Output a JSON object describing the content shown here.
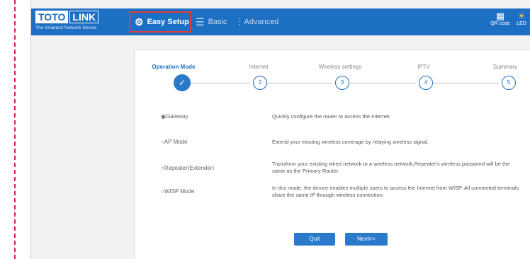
{
  "logo": {
    "toto": "TOTO",
    "link": "LINK",
    "tagline": "The Smartest Network Device"
  },
  "nav": {
    "easy_setup": "Easy Setup",
    "basic": "Basic",
    "advanced": "Advanced"
  },
  "header_tools": {
    "qr_code": "QR code",
    "led": "LED"
  },
  "steps": [
    {
      "label": "Operation Mode",
      "number": "✓",
      "state": "done"
    },
    {
      "label": "Internet",
      "number": "2"
    },
    {
      "label": "Wireless settings",
      "number": "3"
    },
    {
      "label": "IPTV",
      "number": "4"
    },
    {
      "label": "Summary",
      "number": "5"
    }
  ],
  "options": [
    {
      "label": "Gateway",
      "selected": true,
      "desc": "Quickly configure the router to access the Internet."
    },
    {
      "label": "AP Mode",
      "selected": false,
      "desc": "Extend your existing wireless coverage by relaying wireless signal."
    },
    {
      "label": "Repeater(Extender)",
      "selected": false,
      "desc": "Transform your existing wired network to a wireless network,Repeater's wireless password will be the same as the Primary Router."
    },
    {
      "label": "WISP Mode",
      "selected": false,
      "desc": "In this mode, the device enables multiple users to access the Internet from WISP. All connected terminals share the same IP through wireless connection."
    }
  ],
  "buttons": {
    "quit": "Quit",
    "next": "Next>>"
  },
  "colors": {
    "brand_blue": "#1d6fc3",
    "highlight_red": "#e23a3a"
  }
}
